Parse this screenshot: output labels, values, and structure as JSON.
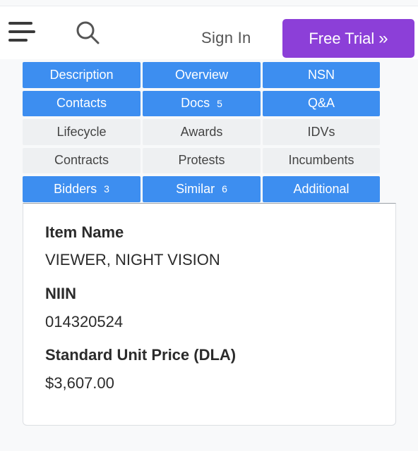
{
  "header": {
    "menu_icon": "hamburger-menu-icon",
    "search_icon": "search-icon",
    "sign_in": "Sign In",
    "free_trial": "Free Trial",
    "free_trial_icon": "»"
  },
  "tabs": [
    {
      "label": "Description",
      "active": true
    },
    {
      "label": "Overview",
      "active": true
    },
    {
      "label": "NSN",
      "active": true
    },
    {
      "label": "Contacts",
      "active": true
    },
    {
      "label": "Docs",
      "count": "5",
      "active": true
    },
    {
      "label": "Q&A",
      "active": true
    },
    {
      "label": "Lifecycle",
      "active": false
    },
    {
      "label": "Awards",
      "active": false
    },
    {
      "label": "IDVs",
      "active": false
    },
    {
      "label": "Contracts",
      "active": false
    },
    {
      "label": "Protests",
      "active": false
    },
    {
      "label": "Incumbents",
      "active": false
    },
    {
      "label": "Bidders",
      "count": "3",
      "active": true
    },
    {
      "label": "Similar",
      "count": "6",
      "active": true
    },
    {
      "label": "Additional",
      "active": true
    }
  ],
  "details": {
    "item_name_label": "Item Name",
    "item_name_value": "VIEWER, NIGHT VISION",
    "niin_label": "NIIN",
    "niin_value": "014320524",
    "price_label": "Standard Unit Price (DLA)",
    "price_value": "$3,607.00"
  },
  "colors": {
    "accent_purple": "#8c3fd8",
    "tab_active_blue": "#3d8ef0",
    "tab_inactive": "#eef0f2"
  }
}
